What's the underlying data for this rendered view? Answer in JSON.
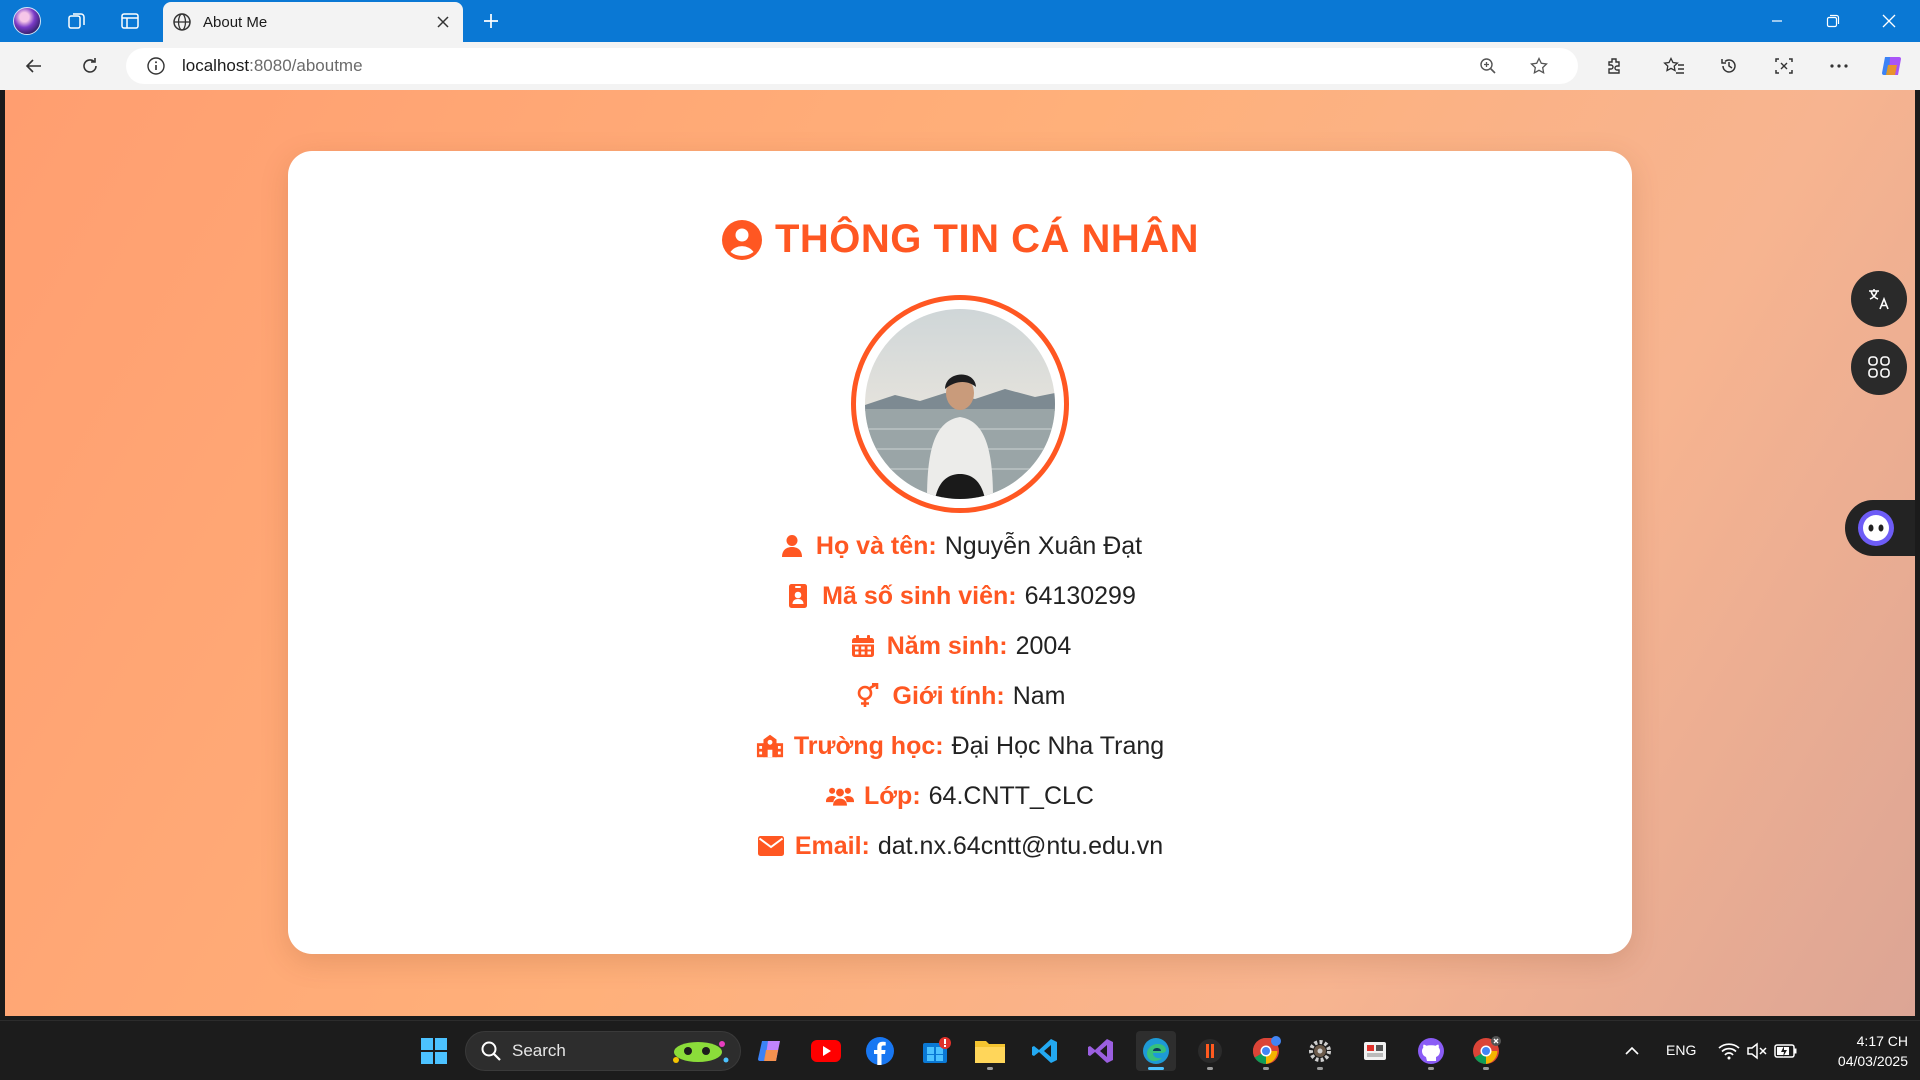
{
  "browser": {
    "tab_title": "About Me",
    "url_host": "localhost",
    "url_rest": ":8080/aboutme"
  },
  "page": {
    "heading": "THÔNG TIN CÁ NHÂN",
    "fields": [
      {
        "icon": "user-icon",
        "label": "Họ và tên:",
        "value": "Nguyễn Xuân Đạt"
      },
      {
        "icon": "id-badge-icon",
        "label": "Mã số sinh viên:",
        "value": "64130299"
      },
      {
        "icon": "calendar-icon",
        "label": "Năm sinh:",
        "value": "2004"
      },
      {
        "icon": "gender-icon",
        "label": "Giới tính:",
        "value": "Nam"
      },
      {
        "icon": "school-icon",
        "label": "Trường học:",
        "value": "Đại Học Nha Trang"
      },
      {
        "icon": "users-icon",
        "label": "Lớp:",
        "value": "64.CNTT_CLC"
      },
      {
        "icon": "envelope-icon",
        "label": "Email:",
        "value": "dat.nx.64cntt@ntu.edu.vn"
      }
    ],
    "accent_color": "#ff5722"
  },
  "taskbar": {
    "search_label": "Search",
    "language": "ENG",
    "time": "4:17 CH",
    "date": "04/03/2025"
  }
}
